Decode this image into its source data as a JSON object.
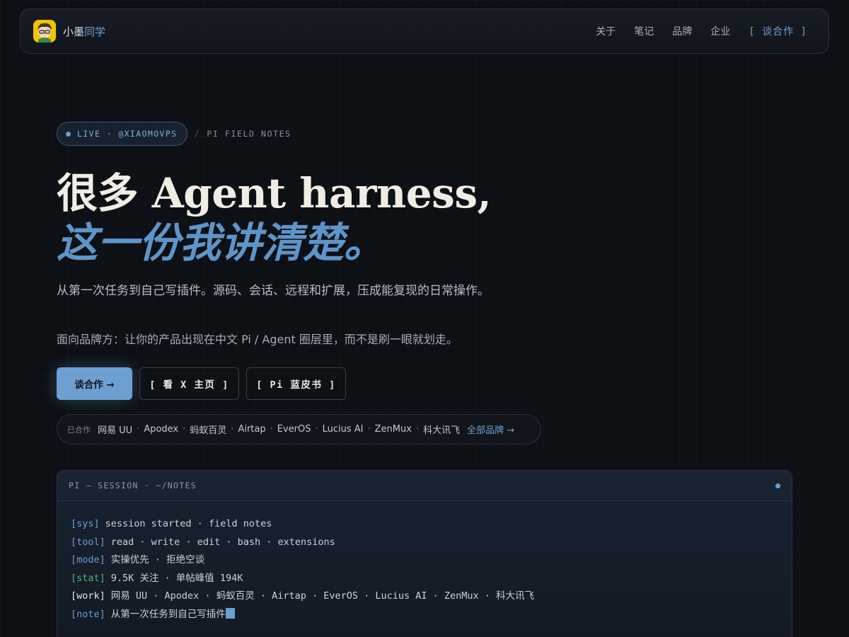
{
  "nav": {
    "brand_main": "小墨",
    "brand_accent": "同学",
    "links": [
      "关于",
      "笔记",
      "品牌",
      "企业"
    ],
    "cta": "[ 谈合作 ]"
  },
  "hero": {
    "live_label": "LIVE · @XIAOMOVPS",
    "slash": "/",
    "field_notes": "PI FIELD NOTES",
    "title_line1": "很多 Agent harness,",
    "title_line2": "这一份我讲清楚。",
    "description": "从第一次任务到自己写插件。源码、会话、远程和扩展，压成能复现的日常操作。",
    "brand_note": "面向品牌方：让你的产品出现在中文 Pi / Agent 圈层里，而不是刷一眼就划走。",
    "buttons": {
      "primary": "谈合作 →",
      "x_home": "[ 看 X 主页 ]",
      "pi_book": "[ Pi 蓝皮书 ]"
    }
  },
  "partners": {
    "label": "已合作",
    "items": [
      "网易 UU",
      "Apodex",
      "蚂蚁百灵",
      "Airtap",
      "EverOS",
      "Lucius AI",
      "ZenMux",
      "科大讯飞"
    ],
    "separator": "·",
    "all_link": "全部品牌 →"
  },
  "terminal": {
    "title": "PI — SESSION · ~/NOTES",
    "lines": [
      {
        "tag": "[sys]",
        "text": "session started · field notes"
      },
      {
        "tag": "[tool]",
        "text": "read · write · edit · bash · extensions"
      },
      {
        "tag": "[mode]",
        "text": "实操优先 · 拒绝空谈"
      },
      {
        "tag": "[stat]",
        "text": "9.5K 关注 · 单帖峰值 194K"
      },
      {
        "tag": "[work]",
        "text": "网易 UU · Apodex · 蚂蚁百灵 · Airtap · EverOS · Lucius AI · ZenMux · 科大讯飞"
      },
      {
        "tag": "[note]",
        "text": "从第一次任务到自己写插件"
      }
    ]
  },
  "colors": {
    "accent": "#6aa0d4",
    "background": "#0d1015",
    "title": "#f1ede4",
    "stat_tag": "#57b37c"
  },
  "icons": {
    "avatar": "avatar-icon",
    "live_dot": "live-dot-icon",
    "terminal_dot": "status-dot-icon",
    "cursor": "cursor-block-icon"
  }
}
